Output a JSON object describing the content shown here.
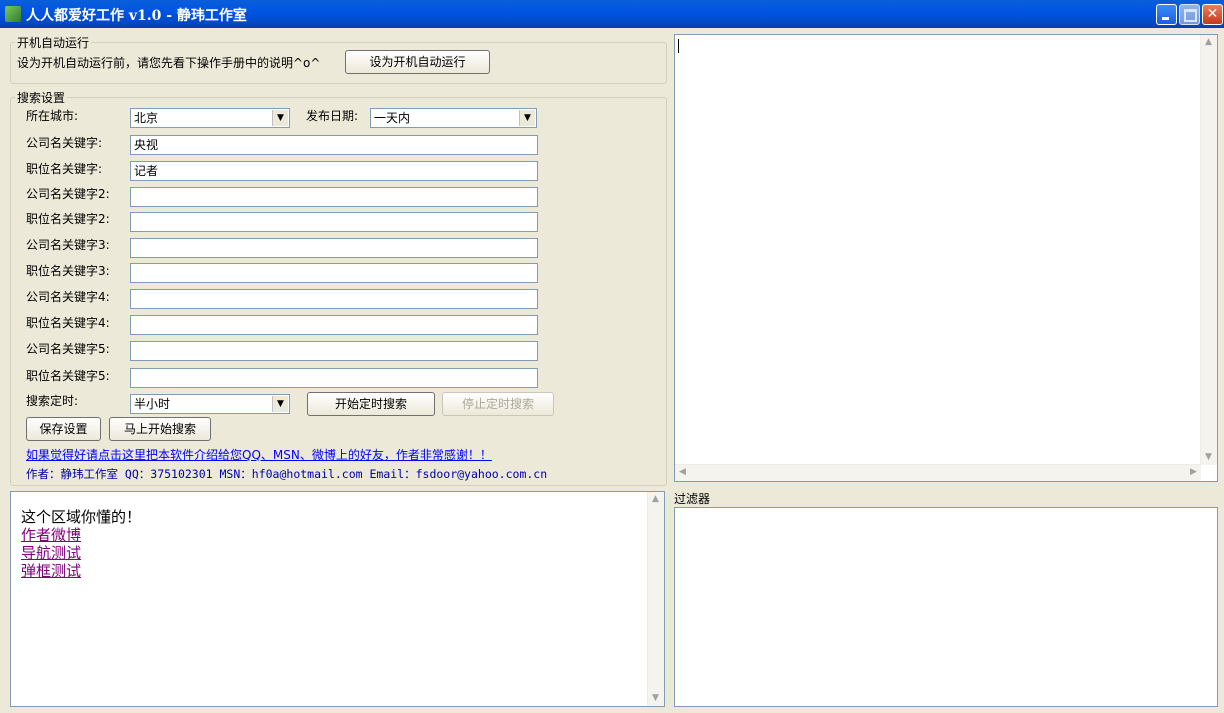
{
  "window": {
    "title": "人人都爱好工作 v1.0 - 静玮工作室"
  },
  "autostart": {
    "legend": "开机自动运行",
    "note": "设为开机自动运行前，请您先看下操作手册中的说明^o^",
    "button": "设为开机自动运行"
  },
  "search": {
    "legend": "搜索设置",
    "city_label": "所在城市:",
    "city_value": "北京",
    "date_label": "发布日期:",
    "date_value": "一天内",
    "keywords": [
      {
        "label": "公司名关键字:",
        "value": "央视"
      },
      {
        "label": "职位名关键字:",
        "value": "记者"
      },
      {
        "label": "公司名关键字2:",
        "value": ""
      },
      {
        "label": "职位名关键字2:",
        "value": ""
      },
      {
        "label": "公司名关键字3:",
        "value": ""
      },
      {
        "label": "职位名关键字3:",
        "value": ""
      },
      {
        "label": "公司名关键字4:",
        "value": ""
      },
      {
        "label": "职位名关键字4:",
        "value": ""
      },
      {
        "label": "公司名关键字5:",
        "value": ""
      },
      {
        "label": "职位名关键字5:",
        "value": ""
      }
    ],
    "timer_label": "搜索定时:",
    "timer_value": "半小时",
    "start_timer": "开始定时搜索",
    "stop_timer": "停止定时搜索",
    "save": "保存设置",
    "search_now": "马上开始搜索",
    "share_link": "如果觉得好请点击这里把本软件介绍给您QQ、MSN、微博上的好友，作者非常感谢！！",
    "author": "作者：静玮工作室 QQ：375102301 MSN：hf0a@hotmail.com Email：fsdoor@yahoo.com.cn"
  },
  "html_panel": {
    "heading": "这个区域你懂的！",
    "links": [
      "作者微博",
      "导航测试",
      "弹框测试"
    ]
  },
  "filter": {
    "label": "过滤器"
  }
}
